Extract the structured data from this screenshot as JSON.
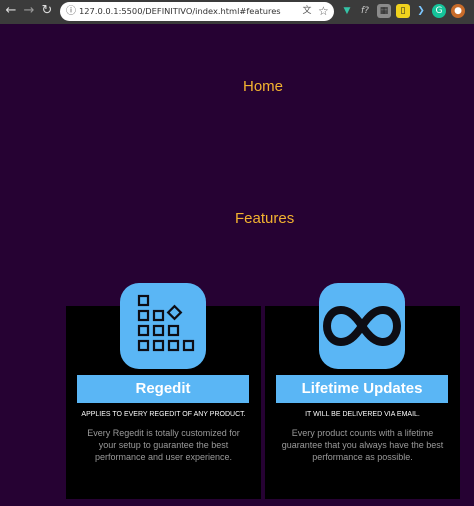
{
  "browser": {
    "url": "127.0.0.1:5500/DEFINITIVO/index.html#features",
    "back_icon": "arrow-left",
    "forward_icon": "arrow-right",
    "reload_icon": "reload"
  },
  "nav": {
    "home_label": "Home",
    "features_label": "Features"
  },
  "cards": [
    {
      "icon": "registry-grid-icon",
      "title": "Regedit",
      "subtitle": "APPLIES TO EVERY REGEDIT OF ANY PRODUCT.",
      "description": "Every Regedit is totally customized for your setup to guarantee the best performance and user experience."
    },
    {
      "icon": "infinity-icon",
      "title": "Lifetime Updates",
      "subtitle": "IT WILL BE DELIVERED VIA EMAIL.",
      "description": "Every product counts with a lifetime guarantee that you always have the best performance as possible."
    }
  ],
  "colors": {
    "background": "#260233",
    "accent": "#5ab6f5",
    "link": "#f2b230",
    "card": "#000000"
  }
}
